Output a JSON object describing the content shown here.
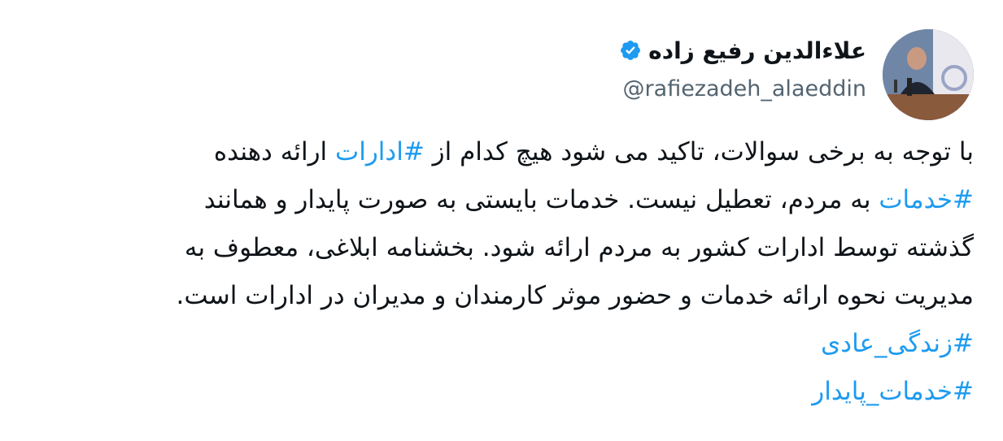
{
  "author": {
    "display_name": "علاءالدین رفیع زاده",
    "handle": "@rafiezadeh_alaeddin",
    "verified": true,
    "verified_icon": "verified-badge-icon",
    "verified_color": "#1d9bf0"
  },
  "tweet": {
    "lines": [
      [
        {
          "type": "text",
          "text": "با توجه به برخی سوالات، تاکید می شود هیچ کدام از "
        },
        {
          "type": "hashtag",
          "text": "#ادارات"
        },
        {
          "type": "text",
          "text": " ارائه دهنده"
        }
      ],
      [
        {
          "type": "hashtag",
          "text": "#خدمات"
        },
        {
          "type": "text",
          "text": " به مردم، تعطیل نیست. خدمات بایستی به صورت پایدار و همانند"
        }
      ],
      [
        {
          "type": "text",
          "text": "گذشته توسط ادارات کشور به مردم ارائه شود. بخشنامه ابلاغی، معطوف به"
        }
      ],
      [
        {
          "type": "text",
          "text": "مدیریت نحوه ارائه خدمات و حضور موثر کارمندان و مدیران در ادارات است."
        }
      ],
      [
        {
          "type": "hashtag",
          "text": "#زندگی_عادی"
        }
      ],
      [
        {
          "type": "hashtag",
          "text": "#خدمات_پایدار"
        }
      ]
    ],
    "hashtag_color": "#1d9bf0",
    "text_color": "#0f1419"
  }
}
